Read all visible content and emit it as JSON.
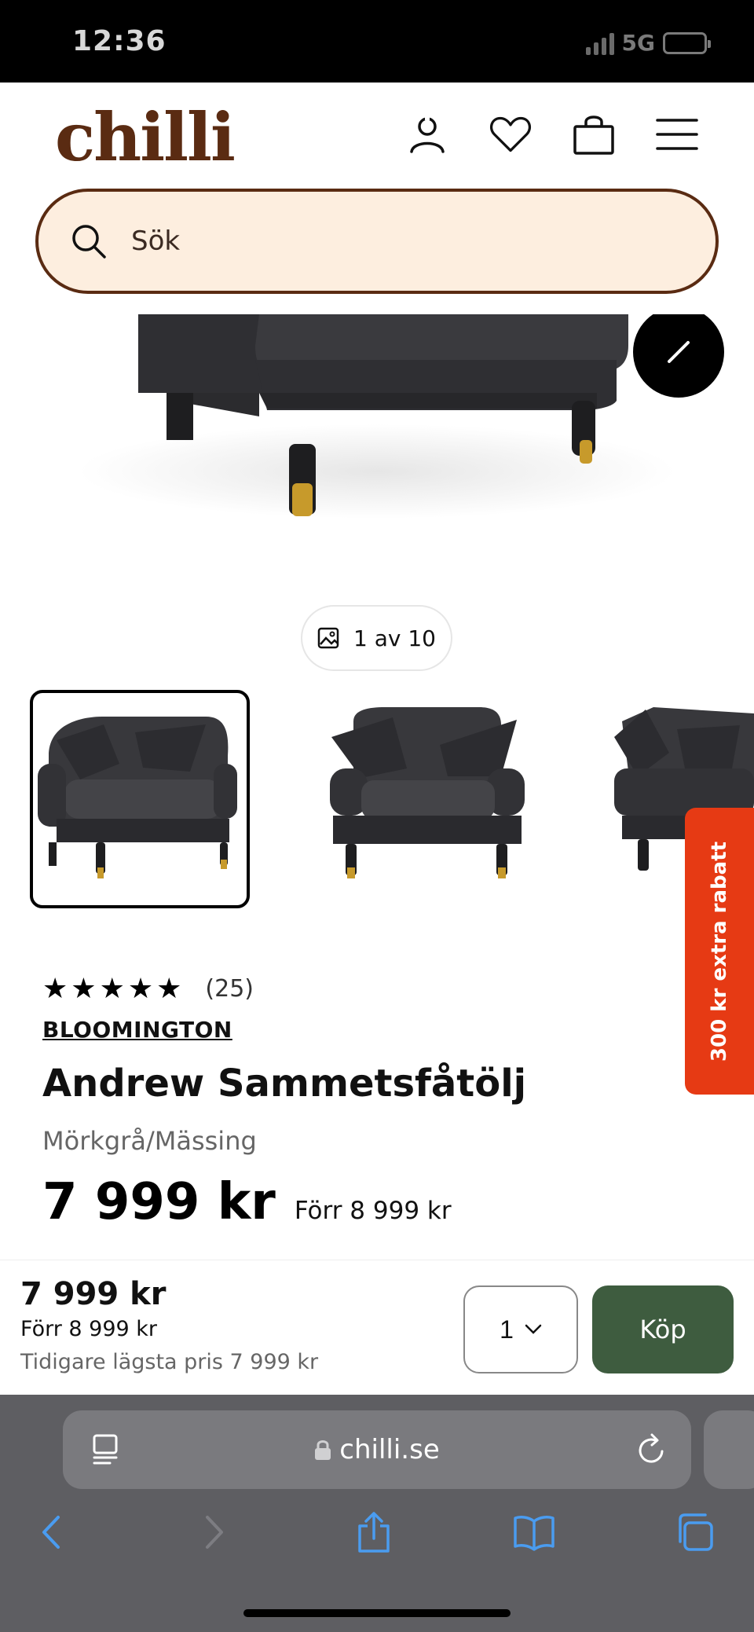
{
  "status_bar": {
    "time": "12:36",
    "network": "5G"
  },
  "header": {
    "logo": "chilli",
    "icons": [
      "account-icon",
      "heart-icon",
      "bag-icon",
      "menu-icon"
    ]
  },
  "search": {
    "placeholder": "Sök"
  },
  "gallery": {
    "counter": "1 av 10"
  },
  "product": {
    "rating_count": "(25)",
    "stars": 5,
    "brand": "BLOOMINGTON",
    "title": "Andrew Sammetsfåtölj",
    "variant": "Mörkgrå/Mässing",
    "price": "7 999 kr",
    "old_price": "Förr 8 999 kr"
  },
  "promo": {
    "label": "300 kr extra rabatt"
  },
  "buybar": {
    "price": "7 999 kr",
    "old_price": "Förr 8 999 kr",
    "lowest_price": "Tidigare lägsta pris 7 999 kr",
    "quantity": "1",
    "buy_label": "Köp"
  },
  "browser": {
    "url": "chilli.se"
  },
  "colors": {
    "brand_brown": "#5a2b12",
    "search_bg": "#fdeedf",
    "buy_green": "#3e5c3f",
    "promo_red": "#e63a14",
    "ios_blue": "#4a9cf0"
  }
}
